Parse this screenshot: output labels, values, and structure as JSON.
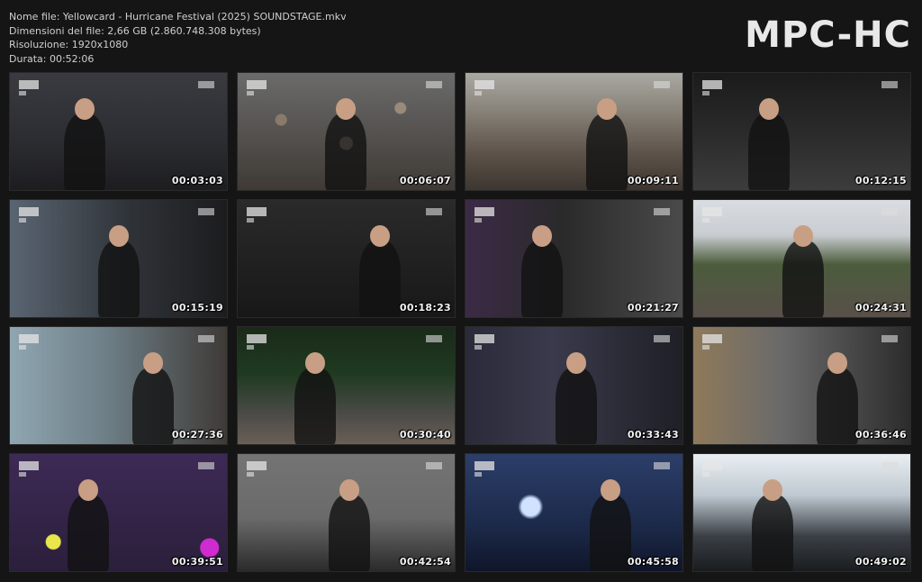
{
  "file_info": {
    "name": "Nome file: Yellowcard - Hurricane Festival (2025) SOUNDSTAGE.mkv",
    "size": "Dimensioni del file: 2,66 GB (2.860.748.308 bytes)",
    "resolution": "Risoluzione: 1920x1080",
    "duration": "Durata: 00:52:06"
  },
  "logo": "MPC-HC",
  "thumbnails": [
    {
      "time": "00:03:03",
      "scene": "s-stage-dark"
    },
    {
      "time": "00:06:07",
      "scene": "s-crowd"
    },
    {
      "time": "00:09:11",
      "scene": "s-crowd-wide"
    },
    {
      "time": "00:12:15",
      "scene": "s-stage-big"
    },
    {
      "time": "00:15:19",
      "scene": "s-closeup"
    },
    {
      "time": "00:18:23",
      "scene": "s-stage-gear"
    },
    {
      "time": "00:21:27",
      "scene": "s-violin"
    },
    {
      "time": "00:24:31",
      "scene": "s-festival"
    },
    {
      "time": "00:27:36",
      "scene": "s-mic"
    },
    {
      "time": "00:30:40",
      "scene": "s-stage-green"
    },
    {
      "time": "00:33:43",
      "scene": "s-singer"
    },
    {
      "time": "00:36:46",
      "scene": "s-violin2"
    },
    {
      "time": "00:39:51",
      "scene": "s-purple"
    },
    {
      "time": "00:42:54",
      "scene": "s-guitar"
    },
    {
      "time": "00:45:58",
      "scene": "s-blue"
    },
    {
      "time": "00:49:02",
      "scene": "s-drum"
    }
  ]
}
